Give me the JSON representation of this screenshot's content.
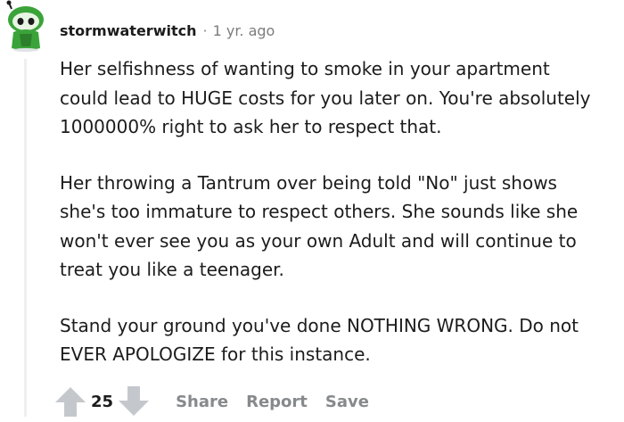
{
  "comment": {
    "username": "stormwaterwitch",
    "separator": "·",
    "age": "1 yr. ago",
    "paragraphs": [
      {
        "lines": [
          "Her selfishness of wanting to smoke in your apartment",
          "could lead to HUGE costs for you later on. You're absolutely",
          "1000000% right to ask her to respect that."
        ]
      },
      {
        "lines": [
          "Her throwing a Tantrum over being told \"No\" just shows",
          "she's too immature to respect others. She sounds like she",
          "won't ever see you as your own Adult and will continue to",
          "treat you like a teenager."
        ]
      },
      {
        "lines": [
          "Stand your ground you've done NOTHING WRONG. Do not",
          "EVER APOLOGIZE for this instance."
        ]
      }
    ],
    "score": "25",
    "actions": {
      "share": "Share",
      "report": "Report",
      "save": "Save"
    }
  },
  "icons": {
    "avatar": "snoo-avatar-icon",
    "upvote": "upvote-arrow-icon",
    "downvote": "downvote-arrow-icon"
  },
  "colors": {
    "avatar_green": "#3aa339",
    "arrow_gray": "#c4c8cc",
    "muted_text": "#878a8c",
    "thread_line": "#edeff1"
  }
}
